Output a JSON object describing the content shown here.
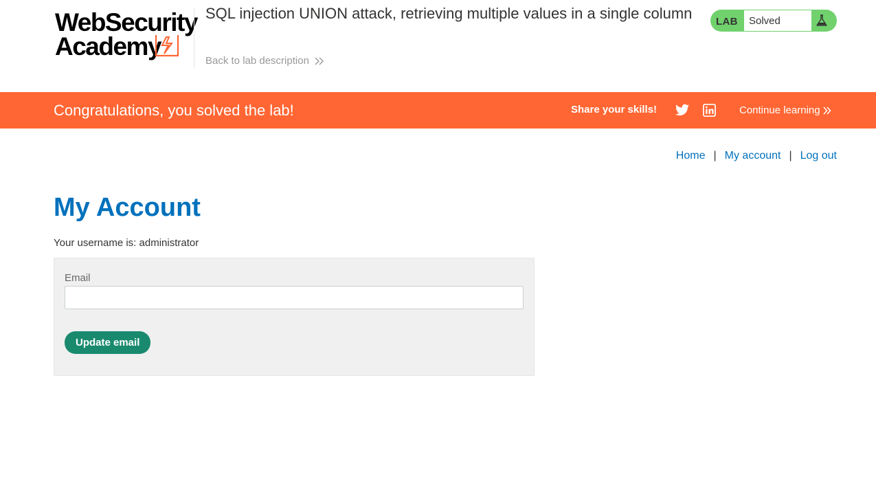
{
  "colors": {
    "brand_orange": "#ff6633",
    "link_blue": "#0071bc",
    "solved_green": "#70d16d",
    "button_green": "#1a8a6f"
  },
  "header": {
    "logo": {
      "line1": "WebSecurity",
      "line2": "Academy",
      "mark_icon": "lightning-bolt-icon"
    },
    "lab_title": "SQL injection UNION attack, retrieving multiple values in a single column",
    "back_link": {
      "label": "Back to lab description",
      "icon": "double-chevron-right-icon"
    },
    "lab_status": {
      "tag": "LAB",
      "value": "Solved",
      "icon": "flask-icon"
    }
  },
  "banner": {
    "message": "Congratulations, you solved the lab!",
    "share_label": "Share your skills!",
    "share_icons": [
      "twitter-icon",
      "linkedin-icon"
    ],
    "continue_label": "Continue learning",
    "continue_icon": "double-chevron-right-icon"
  },
  "nav": {
    "items": [
      {
        "label": "Home"
      },
      {
        "label": "My account"
      },
      {
        "label": "Log out"
      }
    ],
    "separator": "|"
  },
  "main": {
    "title": "My Account",
    "username_prefix": "Your username is: ",
    "username": "administrator",
    "form": {
      "email_label": "Email",
      "email_value": "",
      "submit_label": "Update email"
    }
  }
}
